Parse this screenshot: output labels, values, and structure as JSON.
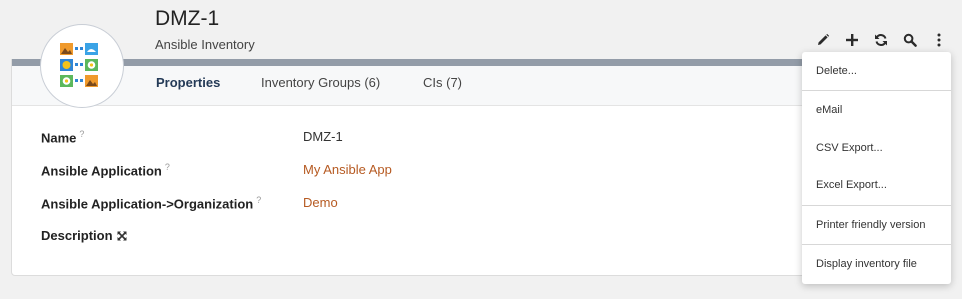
{
  "header": {
    "title": "DMZ-1",
    "subtitle": "Ansible Inventory"
  },
  "toolbar": {
    "icons": [
      "pencil-icon",
      "plus-icon",
      "refresh-icon",
      "search-icon",
      "more-vertical-icon"
    ]
  },
  "tabs": [
    {
      "label": "Properties",
      "active": true
    },
    {
      "label": "Inventory Groups (6)",
      "active": false
    },
    {
      "label": "CIs (7)",
      "active": false
    }
  ],
  "properties": {
    "name": {
      "label": "Name",
      "help": "?",
      "value": "DMZ-1"
    },
    "application": {
      "label": "Ansible Application",
      "help": "?",
      "value": "My Ansible App"
    },
    "organization": {
      "label": "Ansible Application->Organization",
      "help": "?",
      "value": "Demo"
    },
    "description": {
      "label": "Description"
    }
  },
  "menu": {
    "items": [
      "Delete...",
      "eMail",
      "CSV Export...",
      "Excel Export...",
      "Printer friendly version",
      "Display inventory file"
    ]
  },
  "colors": {
    "link": "#b65a22",
    "active_tab": "#243a57",
    "card_bar": "#939ca8"
  }
}
